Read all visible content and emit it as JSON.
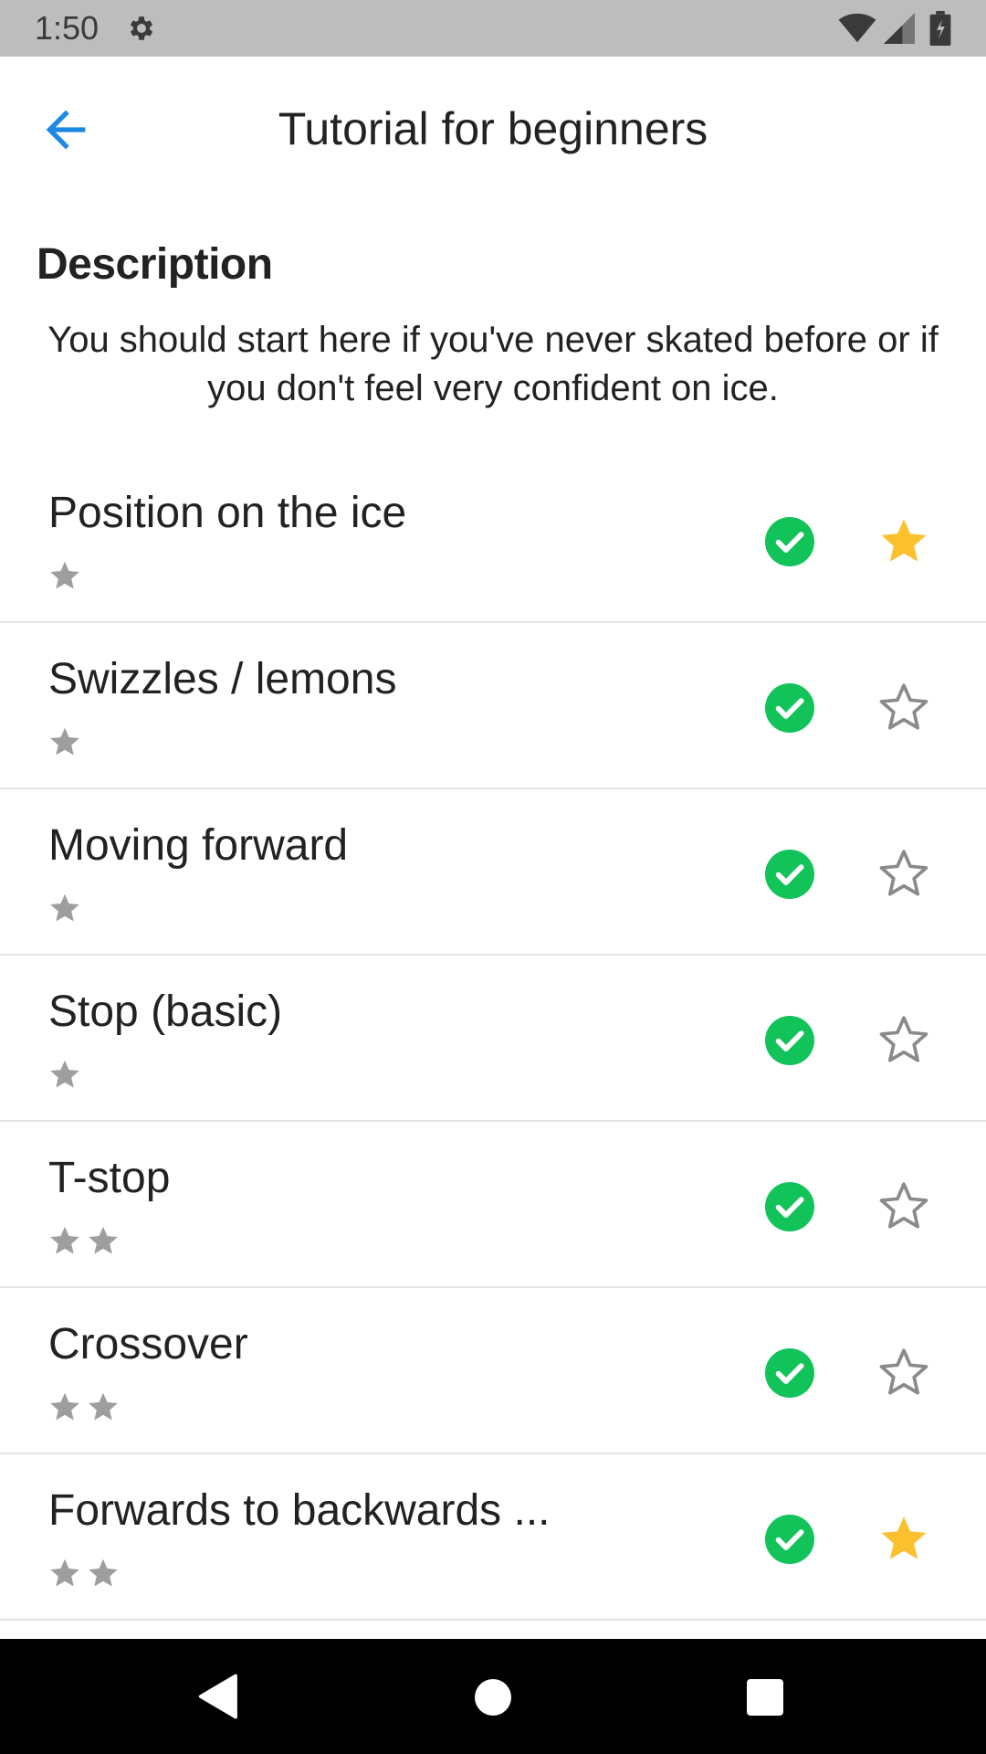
{
  "status_bar": {
    "time": "1:50",
    "icons": [
      "gear-icon",
      "wifi-icon",
      "signal-icon",
      "battery-icon"
    ]
  },
  "app_bar": {
    "title": "Tutorial for beginners",
    "back_icon": "arrow-back-icon",
    "accent_color": "#1e88e5"
  },
  "description": {
    "heading": "Description",
    "text": "You should start here if you've never skated before or if you don't feel very confident on ice."
  },
  "colors": {
    "done_green": "#12c35a",
    "favorite_gold": "#fbc02d",
    "difficulty_gray": "#9e9e9e",
    "outline_gray": "#8a8a8a"
  },
  "lessons": [
    {
      "title": "Position on the ice",
      "difficulty": 1,
      "completed": true,
      "favorite": true
    },
    {
      "title": "Swizzles / lemons",
      "difficulty": 1,
      "completed": true,
      "favorite": false
    },
    {
      "title": "Moving forward",
      "difficulty": 1,
      "completed": true,
      "favorite": false
    },
    {
      "title": "Stop (basic)",
      "difficulty": 1,
      "completed": true,
      "favorite": false
    },
    {
      "title": "T-stop",
      "difficulty": 2,
      "completed": true,
      "favorite": false
    },
    {
      "title": "Crossover",
      "difficulty": 2,
      "completed": true,
      "favorite": false
    },
    {
      "title": "Forwards to backwards ...",
      "difficulty": 2,
      "completed": true,
      "favorite": true
    }
  ],
  "nav_bar": {
    "icons": [
      "nav-back-icon",
      "nav-home-icon",
      "nav-recents-icon"
    ]
  }
}
